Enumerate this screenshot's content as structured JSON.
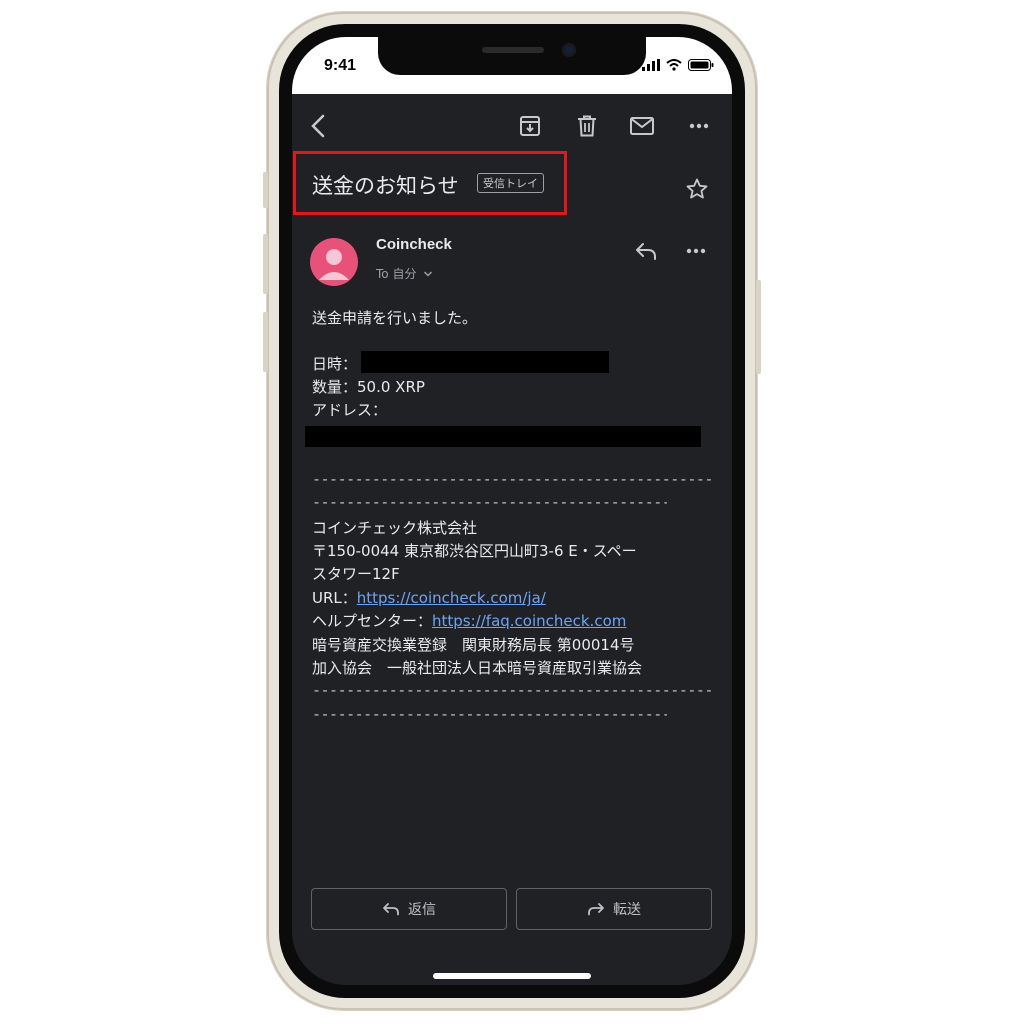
{
  "status_bar": {
    "time": "9:41"
  },
  "email": {
    "subject": "送金のお知らせ",
    "label": "受信トレイ",
    "sender": "Coincheck",
    "recipient": "To 自分",
    "body": {
      "intro": "送金申請を行いました。",
      "datetime_label": "日時：",
      "amount_line": "数量：50.0 XRP",
      "address_label": "アドレス：",
      "separator_line1": "--------------------------------------------------------",
      "separator_line2": "--------------------------------------------------",
      "company": "コインチェック株式会社",
      "address_line1": "〒150-0044 東京都渋谷区円山町3-6 E・スペー",
      "address_line2": "スタワー12F",
      "url_label": "URL：",
      "url": "https://coincheck.com/ja/",
      "help_label": "ヘルプセンター：",
      "help_url": "https://faq.coincheck.com",
      "registration": "暗号資産交換業登録　関東財務局長 第00014号",
      "association": "加入協会　一般社団法人日本暗号資産取引業協会"
    }
  },
  "actions": {
    "reply": "返信",
    "forward": "転送"
  },
  "colors": {
    "background": "#202124",
    "highlight_box": "#e8141a",
    "link": "#6ea3f7",
    "avatar": "#e8527a"
  },
  "icons": [
    "back-icon",
    "archive-icon",
    "trash-icon",
    "mail-icon",
    "more-icon",
    "star-icon",
    "reply-icon",
    "forward-icon"
  ]
}
